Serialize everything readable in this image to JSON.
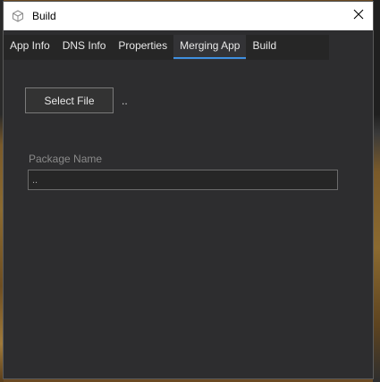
{
  "window": {
    "title": "Build",
    "icon": "cube-icon",
    "close_icon": "close-icon"
  },
  "tabs": [
    {
      "label": "App Info",
      "active": false
    },
    {
      "label": "DNS Info",
      "active": false
    },
    {
      "label": "Properties",
      "active": false
    },
    {
      "label": "Merging App",
      "active": true
    },
    {
      "label": "Build",
      "active": false
    }
  ],
  "merging": {
    "select_file_label": "Select File",
    "file_path": "..",
    "package_name_label": "Package Name",
    "package_name_value": ".."
  },
  "colors": {
    "accent": "#3f8fe0",
    "background": "#2d2d2f"
  }
}
